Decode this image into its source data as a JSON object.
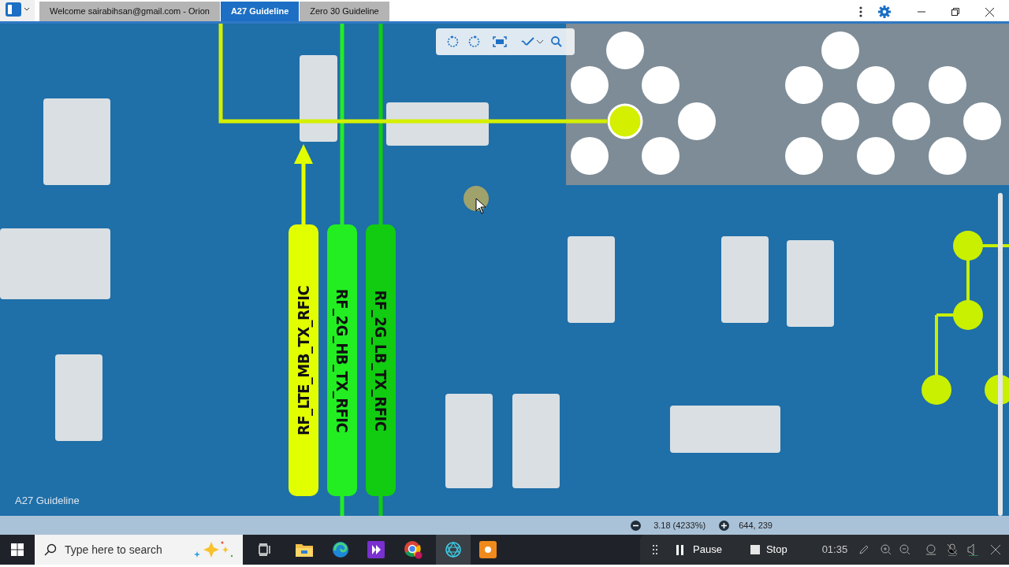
{
  "tabs": [
    {
      "label": "Welcome sairabihsan@gmail.com - Orion",
      "selected": false
    },
    {
      "label": "A27 Guideline",
      "selected": true
    },
    {
      "label": "Zero 30 Guideline",
      "selected": false
    }
  ],
  "signals": [
    {
      "label": "RF_LTE_MB_TX_RFIC",
      "color": "#e2ff00",
      "kind": "up"
    },
    {
      "label": "RF_2G_HB_TX_RFIC",
      "color": "#22ee22",
      "kind": "down"
    },
    {
      "label": "RF_2G_LB_TX_RFIC",
      "color": "#11cc11",
      "kind": "down"
    }
  ],
  "viewer_caption": "A27 Guideline",
  "status_bar": {
    "zoom": "3.18 (4233%)",
    "coordinates": "644, 239"
  },
  "taskbar": {
    "search": {
      "placeholder": "Type here to search"
    }
  },
  "recorder": {
    "pause": "Pause",
    "stop": "Stop",
    "time": "01:35"
  }
}
